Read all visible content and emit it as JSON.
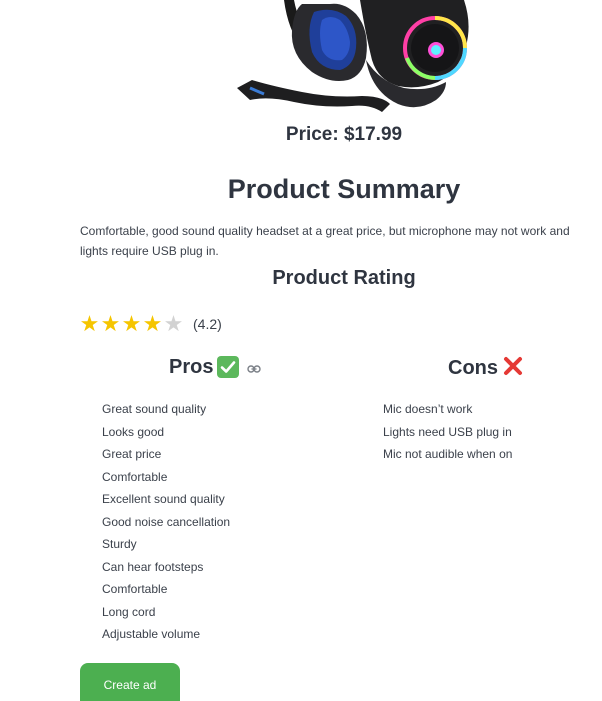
{
  "product": {
    "price_text": "Price: $17.99"
  },
  "summary": {
    "title": "Product Summary",
    "text": "Comfortable, good sound quality headset at a great price, but microphone may not work and lights require USB plug in."
  },
  "rating": {
    "title": "Product Rating",
    "value": 4.2,
    "value_text": "(4.2)",
    "max_stars": 5,
    "filled_stars": 4
  },
  "pros": {
    "title": "Pros",
    "icon": "check-mark-icon",
    "items": [
      "Great sound quality",
      "Looks good",
      "Great price",
      "Comfortable",
      "Excellent sound quality",
      "Good noise cancellation",
      "Sturdy",
      "Can hear footsteps",
      "Comfortable",
      "Long cord",
      "Adjustable volume"
    ]
  },
  "cons": {
    "title": "Cons",
    "icon": "cross-mark-icon",
    "items": [
      "Mic doesn’t work",
      "Lights need USB plug in",
      "Mic not audible when on"
    ]
  },
  "actions": {
    "create_ad_label": "Create ad"
  },
  "colors": {
    "accent_green": "#4caf50",
    "star_gold": "#f5c500",
    "cross_red": "#e53935"
  }
}
